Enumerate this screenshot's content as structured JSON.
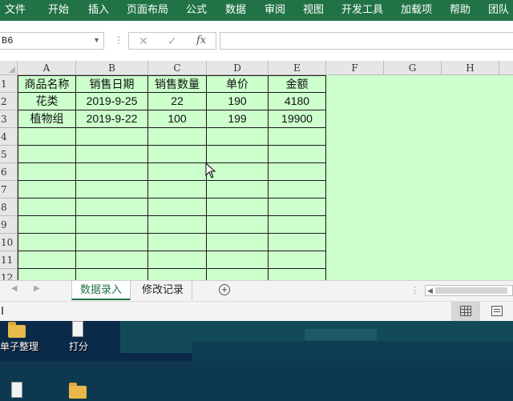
{
  "ribbon": {
    "tabs": [
      "文件",
      "开始",
      "插入",
      "页面布局",
      "公式",
      "数据",
      "审阅",
      "视图",
      "开发工具",
      "加载项",
      "帮助",
      "团队"
    ]
  },
  "formula_bar": {
    "name_box": "B6",
    "cancel_icon": "✕",
    "enter_icon": "✓",
    "fx_label": "fx",
    "formula": ""
  },
  "grid": {
    "columns": [
      "A",
      "B",
      "C",
      "D",
      "E",
      "F",
      "G",
      "H"
    ],
    "rows": [
      "1",
      "2",
      "3",
      "4",
      "5",
      "6",
      "7",
      "8",
      "9",
      "10",
      "11",
      "12"
    ],
    "cells": [
      [
        "商品名称",
        "销售日期",
        "销售数量",
        "单价",
        "金额"
      ],
      [
        "花类",
        "2019-9-25",
        "22",
        "190",
        "4180"
      ],
      [
        "植物组",
        "2019-9-22",
        "100",
        "199",
        "19900"
      ]
    ],
    "fill_color": "#ccffcc"
  },
  "sheet_tabs": {
    "active": "数据录入",
    "inactive": "修改记录",
    "add_icon": "+"
  },
  "desktop": {
    "icons": [
      {
        "label": "单子整理"
      },
      {
        "label": "打分"
      },
      {
        "label": ""
      },
      {
        "label": ""
      }
    ]
  },
  "colors": {
    "ribbon": "#217346",
    "desktop": "#0b2a4a"
  }
}
